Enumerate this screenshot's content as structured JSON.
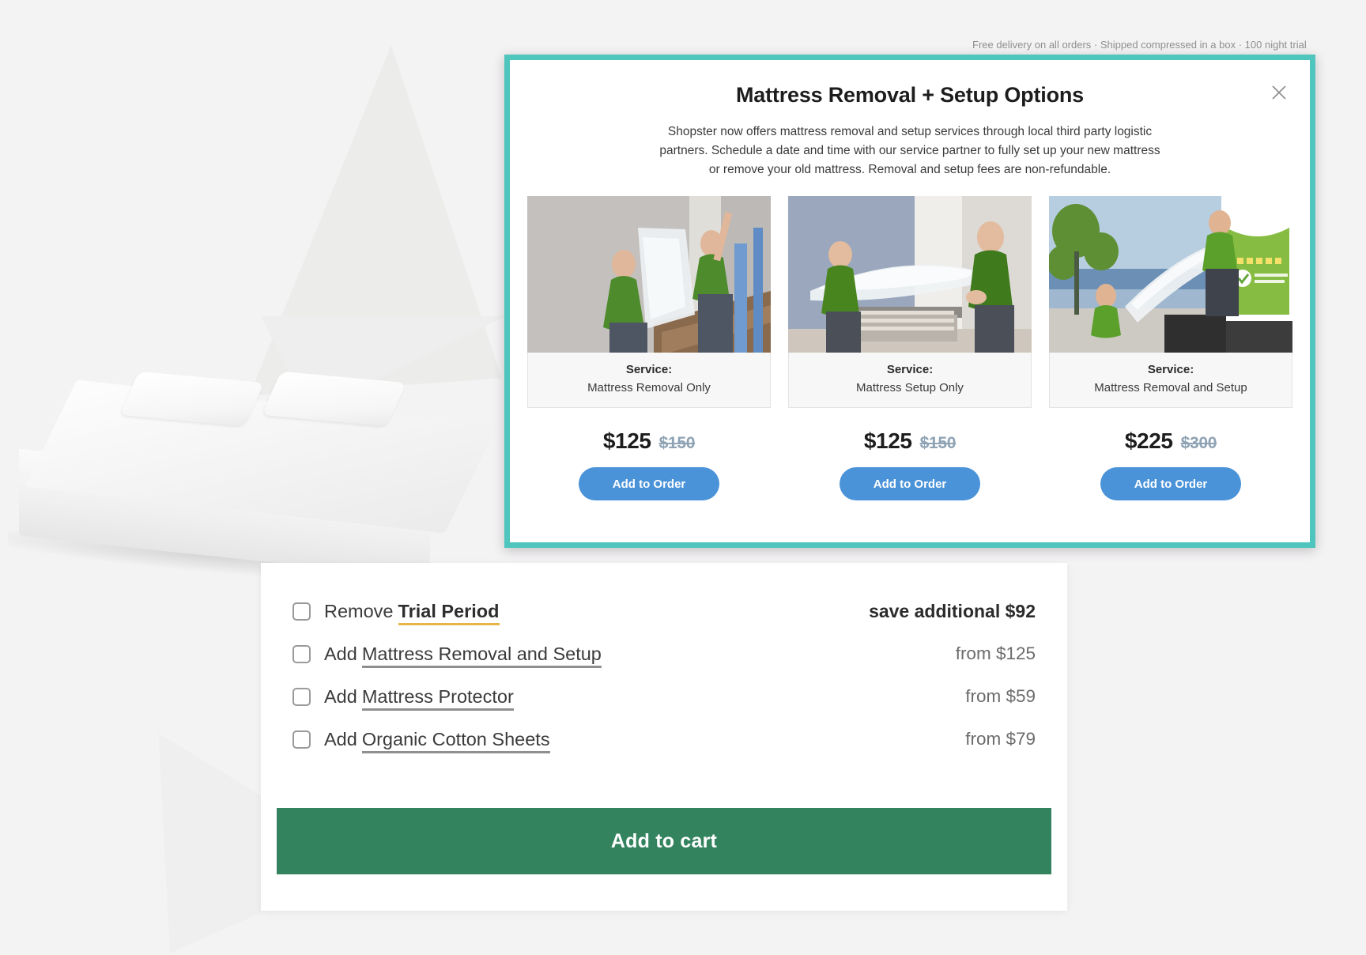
{
  "background": {
    "product_alt": "White mattress with two pillows",
    "clipped_banner_text": "Free delivery on all orders · Shipped compressed in a box · 100 night trial"
  },
  "modal": {
    "title": "Mattress Removal + Setup Options",
    "description": "Shopster now offers mattress removal and setup services through local third party logistic partners. Schedule a date and time with our service partner to fully set up your new mattress or remove your old mattress. Removal and setup fees are non-refundable.",
    "close_icon": "close-icon",
    "border_color": "#4ec5bd",
    "cards": [
      {
        "service_label": "Service:",
        "service_name": "Mattress Removal Only",
        "price_now": "$125",
        "price_was": "$150",
        "button_label": "Add to Order",
        "photo_alt": "Two movers in green shirts carrying a plastic-wrapped mattress down a staircase"
      },
      {
        "service_label": "Service:",
        "service_name": "Mattress Setup Only",
        "price_now": "$125",
        "price_was": "$150",
        "button_label": "Add to Order",
        "photo_alt": "Two movers placing a wrapped mattress onto a bed frame in a blue bedroom"
      },
      {
        "service_label": "Service:",
        "service_name": "Mattress Removal and Setup",
        "price_now": "$225",
        "price_was": "$300",
        "button_label": "Add to Order",
        "photo_alt": "Movers loading a wrapped mattress into a goloadup.com truck outdoors"
      }
    ],
    "button_color": "#4a93d9"
  },
  "options_panel": {
    "rows": [
      {
        "verb": "Remove",
        "emphasis": "Trial Period",
        "emphasis_style": "accent",
        "price": "save additional $92",
        "price_style": "strong"
      },
      {
        "verb": "Add",
        "emphasis": "Mattress Removal and Setup",
        "emphasis_style": "plain",
        "price": "from $125",
        "price_style": "muted"
      },
      {
        "verb": "Add",
        "emphasis": "Mattress Protector",
        "emphasis_style": "plain",
        "price": "from $59",
        "price_style": "muted"
      },
      {
        "verb": "Add",
        "emphasis": "Organic Cotton Sheets",
        "emphasis_style": "plain",
        "price": "from $79",
        "price_style": "muted"
      }
    ],
    "add_to_cart_label": "Add to cart",
    "add_to_cart_color": "#34835f",
    "accent_underline_color": "#e8b548"
  }
}
